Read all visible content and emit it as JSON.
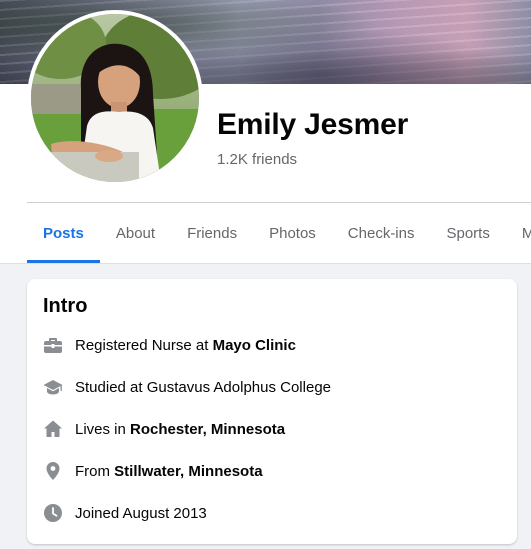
{
  "profile": {
    "name": "Emily Jesmer",
    "friends_count": "1.2K friends"
  },
  "tabs": [
    {
      "label": "Posts",
      "active": true
    },
    {
      "label": "About"
    },
    {
      "label": "Friends"
    },
    {
      "label": "Photos"
    },
    {
      "label": "Check-ins"
    },
    {
      "label": "Sports"
    },
    {
      "label": "More"
    }
  ],
  "intro": {
    "title": "Intro",
    "items": [
      {
        "icon": "briefcase-icon",
        "prefix": "Registered Nurse at ",
        "bold": "Mayo Clinic",
        "suffix": ""
      },
      {
        "icon": "graduation-cap-icon",
        "prefix": "Studied at Gustavus Adolphus College",
        "bold": "",
        "suffix": ""
      },
      {
        "icon": "home-icon",
        "prefix": "Lives in ",
        "bold": "Rochester, Minnesota",
        "suffix": ""
      },
      {
        "icon": "location-pin-icon",
        "prefix": "From ",
        "bold": "Stillwater, Minnesota",
        "suffix": ""
      },
      {
        "icon": "clock-icon",
        "prefix": "Joined August 2013",
        "bold": "",
        "suffix": ""
      }
    ]
  },
  "colors": {
    "accent": "#1b74e4",
    "secondary_text": "#65676b",
    "icon_gray": "#8a8d91",
    "page_background": "#f0f2f5"
  }
}
